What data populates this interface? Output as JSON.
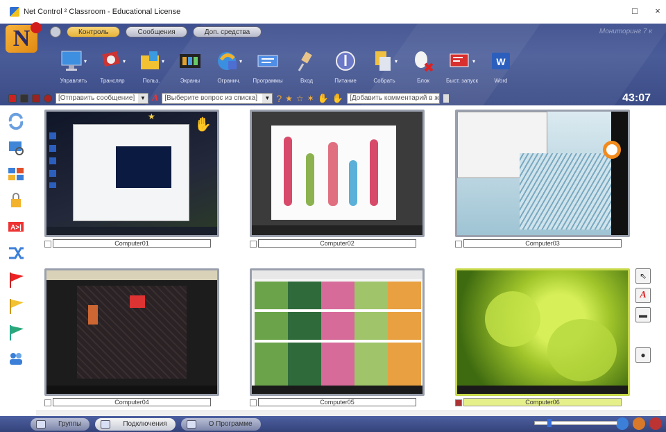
{
  "window": {
    "title": "Net Control ² Classroom - Educational License",
    "close": "×",
    "maximize": "□"
  },
  "tabs": [
    {
      "label": "Контроль",
      "active": true
    },
    {
      "label": "Сообщения",
      "active": false
    },
    {
      "label": "Доп. средства",
      "active": false
    }
  ],
  "topright_text": "Мониторинг 7 к",
  "toolbar": [
    {
      "label": "Управлять",
      "icon": "monitor-icon"
    },
    {
      "label": "Трансляр",
      "icon": "broadcast-icon"
    },
    {
      "label": "Польз.",
      "icon": "user-folder-icon"
    },
    {
      "label": "Экраны",
      "icon": "film-strip-icon"
    },
    {
      "label": "Огранич.",
      "icon": "restrict-browser-icon"
    },
    {
      "label": "Программы",
      "icon": "programs-icon"
    },
    {
      "label": "Вход",
      "icon": "login-pin-icon"
    },
    {
      "label": "Питание",
      "icon": "power-icon"
    },
    {
      "label": "Собрать",
      "icon": "collect-files-icon"
    },
    {
      "label": "Блок",
      "icon": "block-mouse-icon"
    },
    {
      "label": "Быст. запуск",
      "icon": "quick-launch-icon"
    },
    {
      "label": "Word",
      "icon": "word-icon"
    }
  ],
  "strip": {
    "message_combo": "[Отправить сообщение]",
    "question_combo": "[Выберите вопрос из списка]",
    "comment_combo": "[Добавить комментарий в жу"
  },
  "timer": "43:07",
  "computers": [
    {
      "name": "Computer01",
      "selected": false
    },
    {
      "name": "Computer02",
      "selected": false
    },
    {
      "name": "Computer03",
      "selected": false
    },
    {
      "name": "Computer04",
      "selected": false
    },
    {
      "name": "Computer05",
      "selected": false
    },
    {
      "name": "Computer06",
      "selected": true
    }
  ],
  "bottom_tabs": [
    {
      "label": "Группы",
      "active": false
    },
    {
      "label": "Подключения",
      "active": true
    },
    {
      "label": "О Программе",
      "active": false
    }
  ],
  "colors": {
    "ribbon": "#3d4f8e",
    "tab_active": "#e7b339",
    "selected": "#c7d84a"
  }
}
